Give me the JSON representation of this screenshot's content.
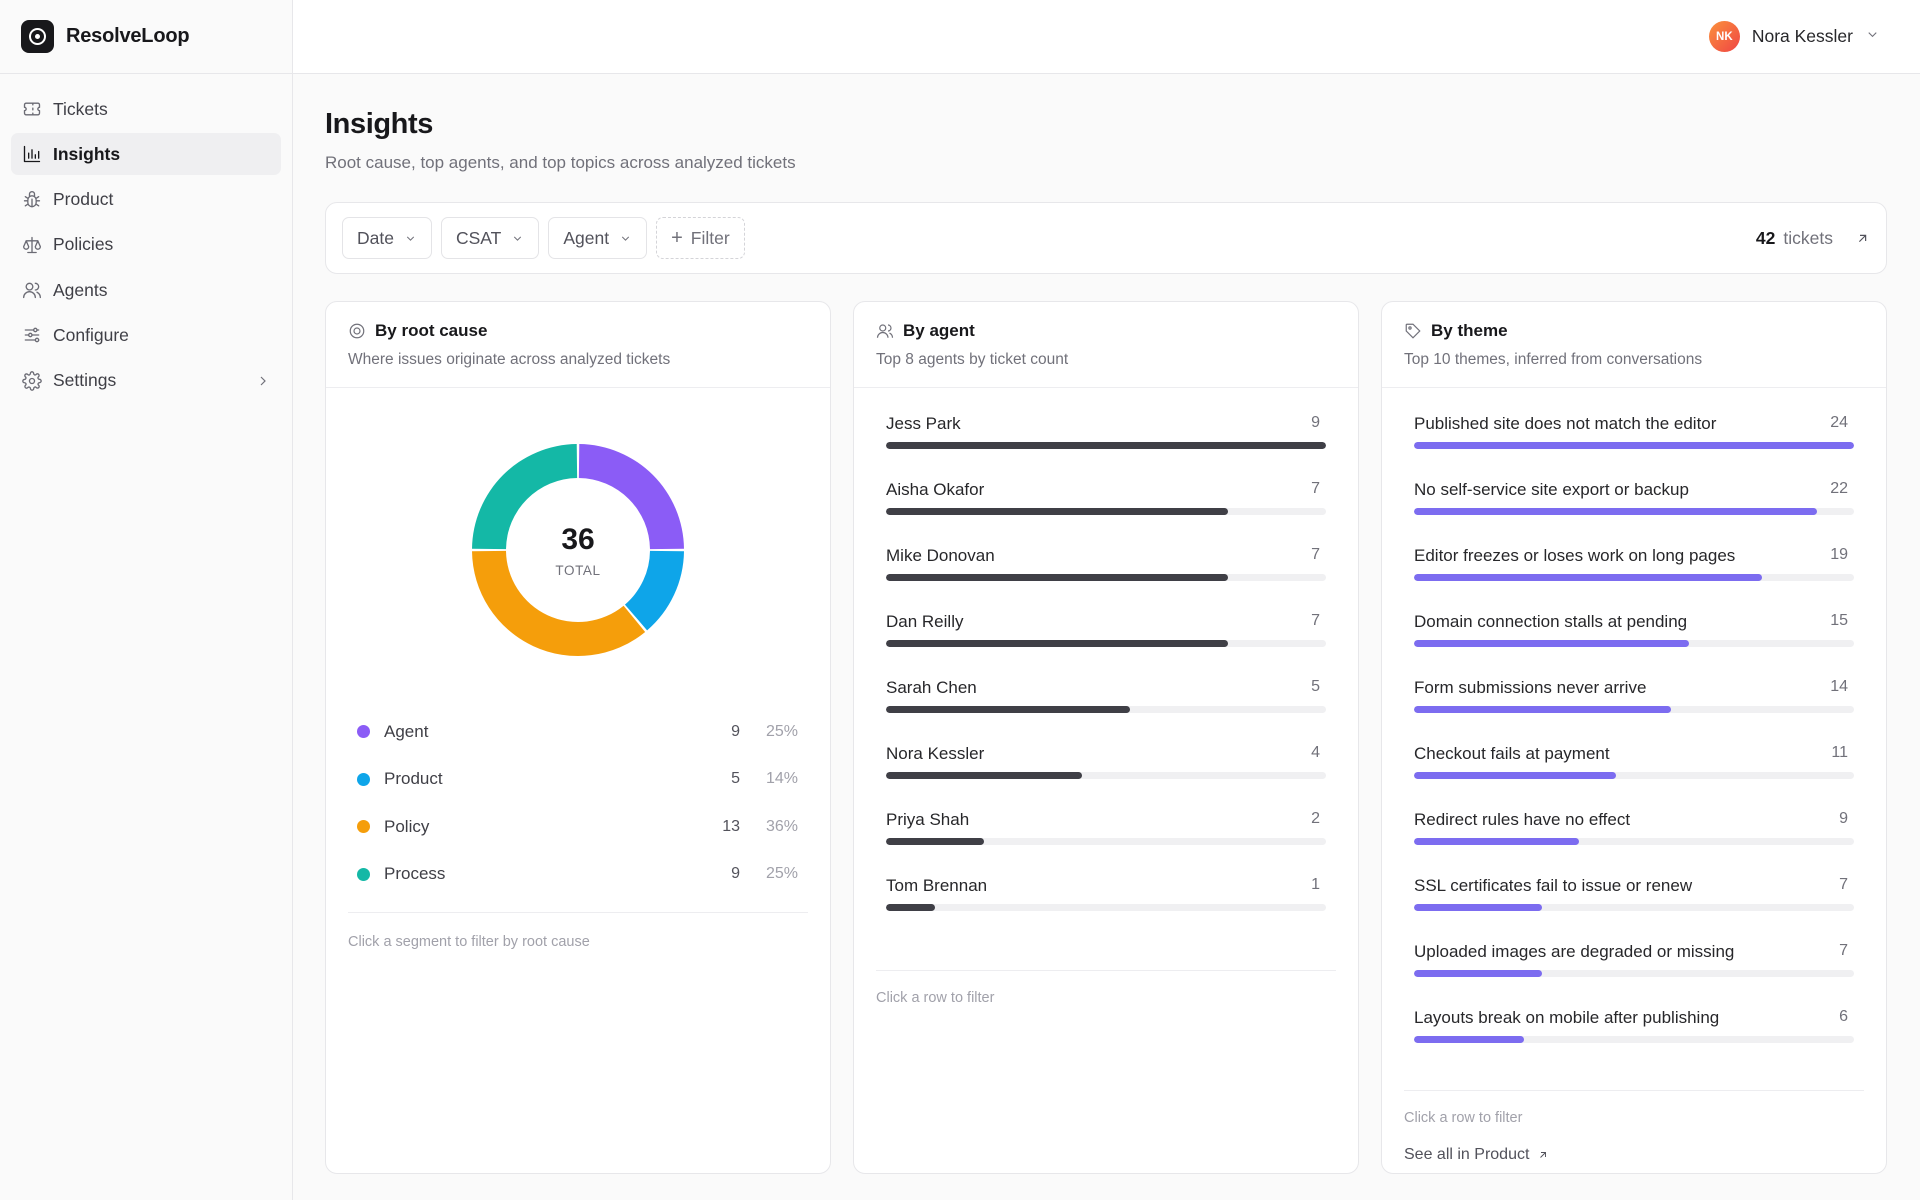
{
  "app": {
    "name": "ResolveLoop"
  },
  "sidebar": {
    "items": [
      {
        "label": "Tickets",
        "icon": "ticket-icon"
      },
      {
        "label": "Insights",
        "icon": "bar-chart-icon",
        "active": true
      },
      {
        "label": "Product",
        "icon": "bug-icon"
      },
      {
        "label": "Policies",
        "icon": "scale-icon"
      },
      {
        "label": "Agents",
        "icon": "users-icon"
      },
      {
        "label": "Configure",
        "icon": "sliders-icon"
      },
      {
        "label": "Settings",
        "icon": "gear-icon",
        "has_submenu": true
      }
    ]
  },
  "user": {
    "initials": "NK",
    "name": "Nora Kessler"
  },
  "page": {
    "title": "Insights",
    "subtitle": "Root cause, top agents, and top topics across analyzed tickets"
  },
  "filters": {
    "chips": [
      "Date",
      "CSAT",
      "Agent"
    ],
    "add_label": "Filter",
    "ticket_count": "42",
    "ticket_label": "tickets"
  },
  "root_cause": {
    "title": "By root cause",
    "subtitle": "Where issues originate across analyzed tickets",
    "total": "36",
    "total_label": "TOTAL",
    "hint": "Click a segment to filter by root cause",
    "items": [
      {
        "label": "Agent",
        "count": "9",
        "pct": "25%",
        "color": "#8b5cf6"
      },
      {
        "label": "Product",
        "count": "5",
        "pct": "14%",
        "color": "#0ea5e9"
      },
      {
        "label": "Policy",
        "count": "13",
        "pct": "36%",
        "color": "#f59e0b"
      },
      {
        "label": "Process",
        "count": "9",
        "pct": "25%",
        "color": "#14b8a6"
      }
    ]
  },
  "agents": {
    "title": "By agent",
    "subtitle": "Top 8 agents by ticket count",
    "hint": "Click a row to filter",
    "max": 9,
    "items": [
      {
        "label": "Jess Park",
        "value": "9"
      },
      {
        "label": "Aisha Okafor",
        "value": "7"
      },
      {
        "label": "Mike Donovan",
        "value": "7"
      },
      {
        "label": "Dan Reilly",
        "value": "7"
      },
      {
        "label": "Sarah Chen",
        "value": "5"
      },
      {
        "label": "Nora Kessler",
        "value": "4"
      },
      {
        "label": "Priya Shah",
        "value": "2"
      },
      {
        "label": "Tom Brennan",
        "value": "1"
      }
    ]
  },
  "themes": {
    "title": "By theme",
    "subtitle": "Top 10 themes, inferred from conversations",
    "hint": "Click a row to filter",
    "see_all": "See all in Product",
    "max": 24,
    "items": [
      {
        "label": "Published site does not match the editor",
        "value": "24"
      },
      {
        "label": "No self-service site export or backup",
        "value": "22"
      },
      {
        "label": "Editor freezes or loses work on long pages",
        "value": "19"
      },
      {
        "label": "Domain connection stalls at pending",
        "value": "15"
      },
      {
        "label": "Form submissions never arrive",
        "value": "14"
      },
      {
        "label": "Checkout fails at payment",
        "value": "11"
      },
      {
        "label": "Redirect rules have no effect",
        "value": "9"
      },
      {
        "label": "SSL certificates fail to issue or renew",
        "value": "7"
      },
      {
        "label": "Uploaded images are degraded or missing",
        "value": "7"
      },
      {
        "label": "Layouts break on mobile after publishing",
        "value": "6"
      }
    ]
  },
  "chart_data": {
    "type": "pie",
    "categories": [
      "Agent",
      "Product",
      "Policy",
      "Process"
    ],
    "values": [
      9,
      5,
      13,
      9
    ],
    "title": "By root cause"
  }
}
